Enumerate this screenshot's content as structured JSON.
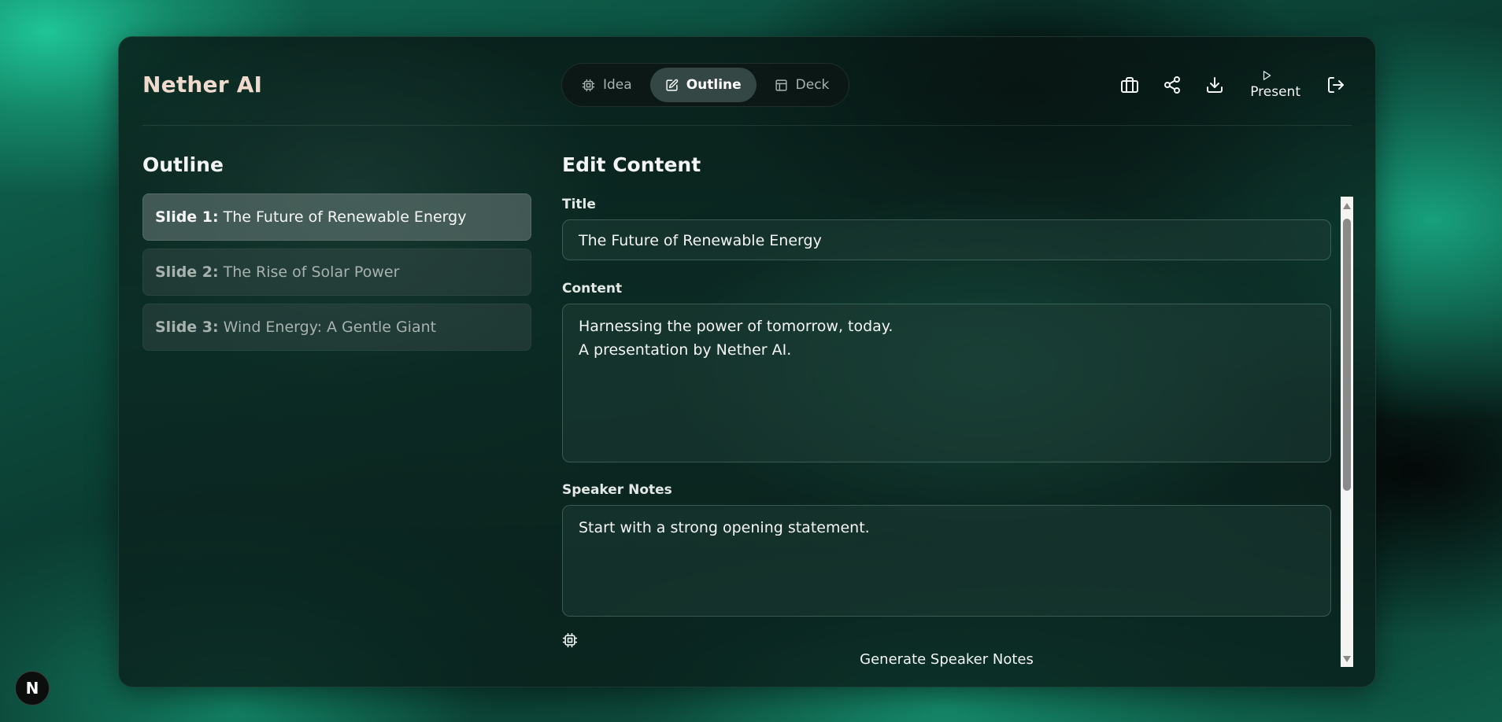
{
  "app": {
    "brand": "Nether AI"
  },
  "tabs": [
    {
      "label": "Idea",
      "icon": "cpu-icon",
      "active": false
    },
    {
      "label": "Outline",
      "icon": "edit-icon",
      "active": true
    },
    {
      "label": "Deck",
      "icon": "layout-icon",
      "active": false
    }
  ],
  "actions": {
    "present_label": "Present",
    "icons": [
      "briefcase-icon",
      "share-icon",
      "download-icon",
      "play-icon",
      "logout-icon"
    ]
  },
  "outline": {
    "title": "Outline",
    "slides": [
      {
        "prefix": "Slide 1:",
        "title": "The Future of Renewable Energy",
        "active": true
      },
      {
        "prefix": "Slide 2:",
        "title": "The Rise of Solar Power",
        "active": false
      },
      {
        "prefix": "Slide 3:",
        "title": "Wind Energy: A Gentle Giant",
        "active": false
      }
    ]
  },
  "editor": {
    "heading": "Edit Content",
    "title_label": "Title",
    "title_value": "The Future of Renewable Energy",
    "content_label": "Content",
    "content_value": "Harnessing the power of tomorrow, today.\nA presentation by Nether AI.",
    "notes_label": "Speaker Notes",
    "notes_value": "Start with a strong opening statement.",
    "generate_label": "Generate Speaker Notes"
  },
  "badge": {
    "letter": "N"
  },
  "colors": {
    "brand": "#f0d9cd",
    "accent": "#17a07c"
  }
}
